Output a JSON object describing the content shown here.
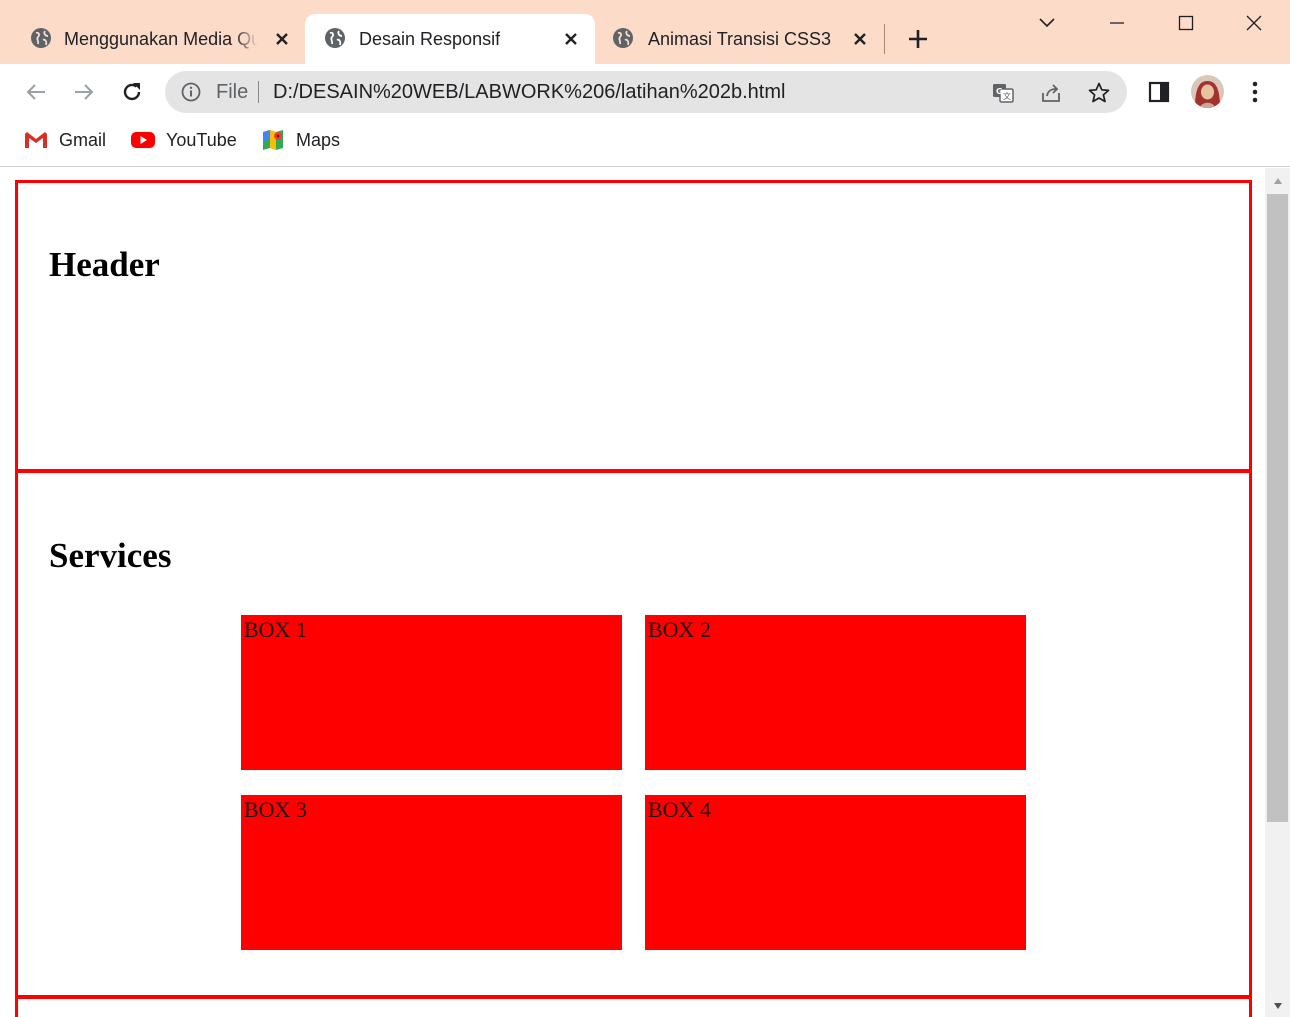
{
  "tabs": [
    {
      "title": "Menggunakan Media Queries",
      "icon": "globe-icon",
      "active": false
    },
    {
      "title": "Desain Responsif",
      "icon": "globe-icon",
      "active": true
    },
    {
      "title": "Animasi Transisi CSS3",
      "icon": "globe-icon",
      "active": false
    }
  ],
  "omnibox": {
    "scheme_label": "File",
    "url": "D:/DESAIN%20WEB/LABWORK%206/latihan%202b.html"
  },
  "bookmarks": [
    {
      "label": "Gmail",
      "icon": "gmail-icon"
    },
    {
      "label": "YouTube",
      "icon": "youtube-icon"
    },
    {
      "label": "Maps",
      "icon": "maps-icon"
    }
  ],
  "page": {
    "header_title": "Header",
    "services_title": "Services",
    "boxes": [
      "BOX 1",
      "BOX 2",
      "BOX 3",
      "BOX 4"
    ]
  },
  "colors": {
    "tab_strip": "#fcdbc9",
    "section_border": "#ff0000",
    "box_fill": "#ff0000"
  }
}
